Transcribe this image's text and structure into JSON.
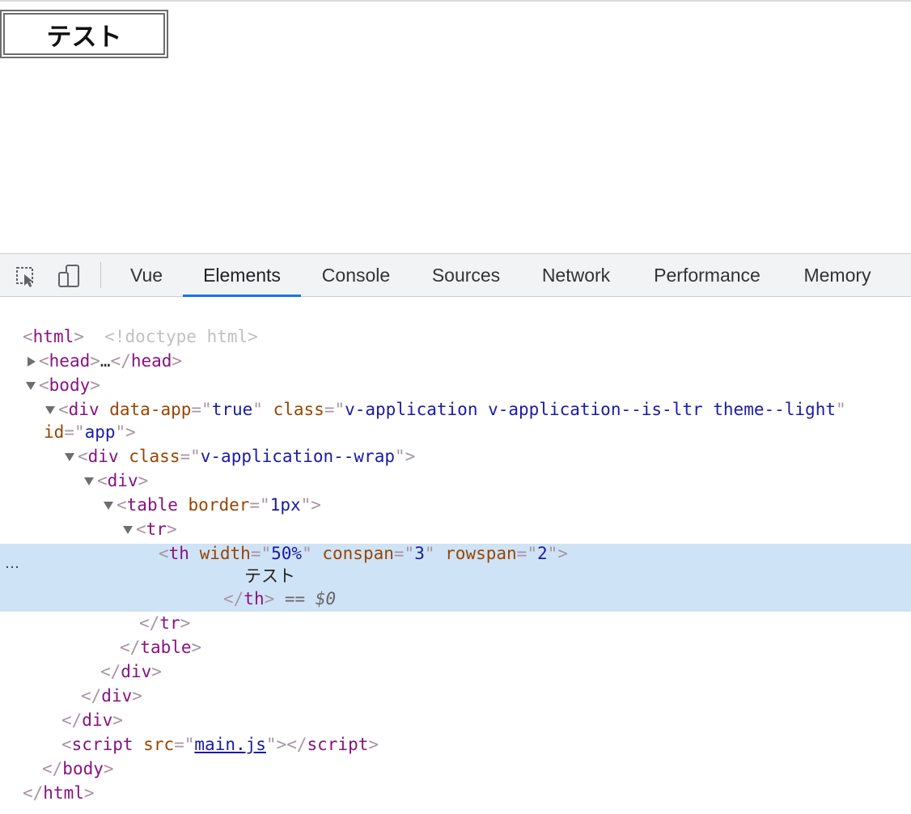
{
  "page": {
    "table_cell_text": "テスト"
  },
  "devtools": {
    "toolbar_icons": [
      "inspect-element-icon",
      "device-toggle-icon"
    ],
    "tabs": [
      "Vue",
      "Elements",
      "Console",
      "Sources",
      "Network",
      "Performance",
      "Memory"
    ],
    "active_tab": "Elements",
    "colors": {
      "tag": "#881280",
      "attribute": "#994500",
      "value": "#1a1aa6",
      "selection": "#cfe3f7",
      "active_tab_underline": "#1a73e8"
    }
  },
  "tree": {
    "doctype": "<!doctype html>",
    "html_open": "html",
    "head": "head",
    "head_ellipsis": "…",
    "body": "body",
    "div_app": {
      "tag": "div",
      "a1": "data-app",
      "v1": "true",
      "a2": "class",
      "v2": "v-application v-application--is-ltr theme--light",
      "a3": "id",
      "v3": "app"
    },
    "div_wrap": {
      "tag": "div",
      "a1": "class",
      "v1": "v-application--wrap"
    },
    "div_plain": "div",
    "table": {
      "tag": "table",
      "a1": "border",
      "v1": "1px"
    },
    "tr": "tr",
    "th": {
      "tag": "th",
      "a1": "width",
      "v1": "50%",
      "a2": "conspan",
      "v2": "3",
      "a3": "rowspan",
      "v3": "2",
      "text": "テスト",
      "selected_marker": "== $0"
    },
    "script": {
      "tag": "script",
      "a1": "src",
      "v1": "main.js"
    },
    "more_dots": "…"
  }
}
